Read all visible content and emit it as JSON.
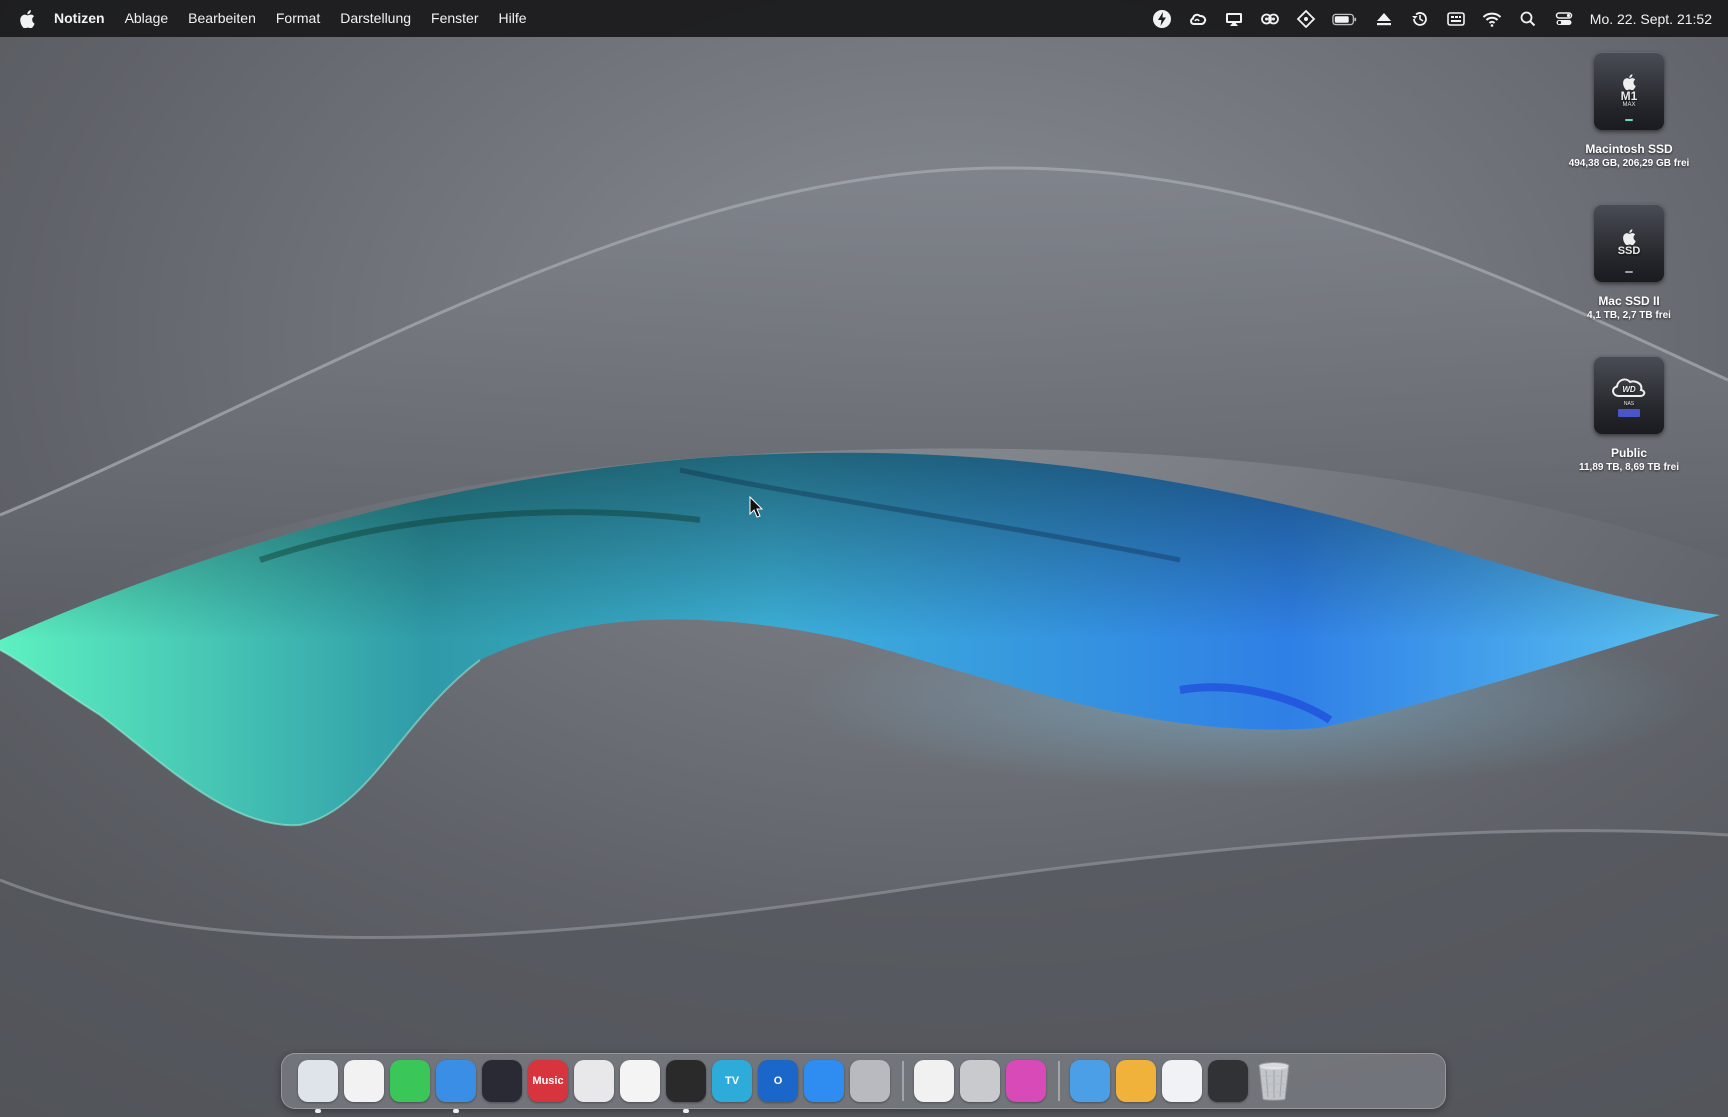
{
  "menubar": {
    "apple_icon": "apple-logo-icon",
    "app_name": "Notizen",
    "menus": [
      "Ablage",
      "Bearbeiten",
      "Format",
      "Darstellung",
      "Fenster",
      "Hilfe"
    ],
    "status_icons": [
      "lightning-icon",
      "creative-cloud-icon",
      "cast-icon",
      "mask-icon",
      "move-icon",
      "battery-icon",
      "eject-icon",
      "time-machine-icon",
      "keyboard-icon",
      "wifi-icon",
      "search-icon",
      "control-center-icon"
    ],
    "clock": "Mo. 22. Sept. 21:52"
  },
  "desktop": {
    "drives": [
      {
        "name": "Macintosh SSD",
        "info": "494,38 GB, 206,29 GB frei",
        "icon_label": "M1",
        "icon_sub": "MAX",
        "icon": "internal-drive-icon"
      },
      {
        "name": "Mac SSD II",
        "info": "4,1 TB, 2,7 TB frei",
        "icon_label": "SSD",
        "icon_sub": "",
        "icon": "external-drive-icon"
      },
      {
        "name": "Public",
        "info": "11,89 TB, 8,69 TB frei",
        "icon_label": "WD",
        "icon_sub": "NAS",
        "icon": "network-drive-icon"
      }
    ]
  },
  "dock": {
    "apps": [
      {
        "icon": "finder-icon",
        "color": "#dfe3ea",
        "label": "",
        "running": true
      },
      {
        "icon": "launchpad-icon",
        "color": "#f2f2f2",
        "label": "",
        "running": false
      },
      {
        "icon": "messages-icon",
        "color": "#3bc65a",
        "label": "",
        "running": false
      },
      {
        "icon": "safari-icon",
        "color": "#3a8ee6",
        "label": "",
        "running": true
      },
      {
        "icon": "firefox-icon",
        "color": "#2a2a35",
        "label": "",
        "running": false
      },
      {
        "icon": "music-icon",
        "color": "#d8343d",
        "label": "Music",
        "running": false
      },
      {
        "icon": "color-picker-icon",
        "color": "#e8e8ea",
        "label": "",
        "running": false
      },
      {
        "icon": "calendar-icon",
        "color": "#f4f4f4",
        "label": "",
        "running": false
      },
      {
        "icon": "notes-z-icon",
        "color": "#2a2a2a",
        "label": "",
        "running": true
      },
      {
        "icon": "apple-tv-icon",
        "color": "#2dabd9",
        "label": "TV",
        "running": false
      },
      {
        "icon": "outlook-icon",
        "color": "#1a66c9",
        "label": "O",
        "running": false
      },
      {
        "icon": "app-store-icon",
        "color": "#2f8cf0",
        "label": "",
        "running": false
      },
      {
        "icon": "gpu-monitor-icon",
        "color": "#b8bac0",
        "label": "",
        "running": false
      },
      {
        "icon": "photoshop-script-icon",
        "color": "#f1f1f1",
        "label": "",
        "running": false
      },
      {
        "icon": "recycle-icon",
        "color": "#c9cacd",
        "label": "",
        "running": false
      },
      {
        "icon": "cleaner-icon",
        "color": "#d84ab8",
        "label": "",
        "running": false
      },
      {
        "icon": "downloads-folder-icon",
        "color": "#4b9fe6",
        "label": "",
        "running": false
      },
      {
        "icon": "applications-folder-icon",
        "color": "#f0b23a",
        "label": "",
        "running": false
      },
      {
        "icon": "airdrop-icon",
        "color": "#f0f2f5",
        "label": "",
        "running": false
      },
      {
        "icon": "screenshot-icon",
        "color": "#303236",
        "label": "",
        "running": false
      }
    ],
    "trash_icon": "trash-icon"
  }
}
